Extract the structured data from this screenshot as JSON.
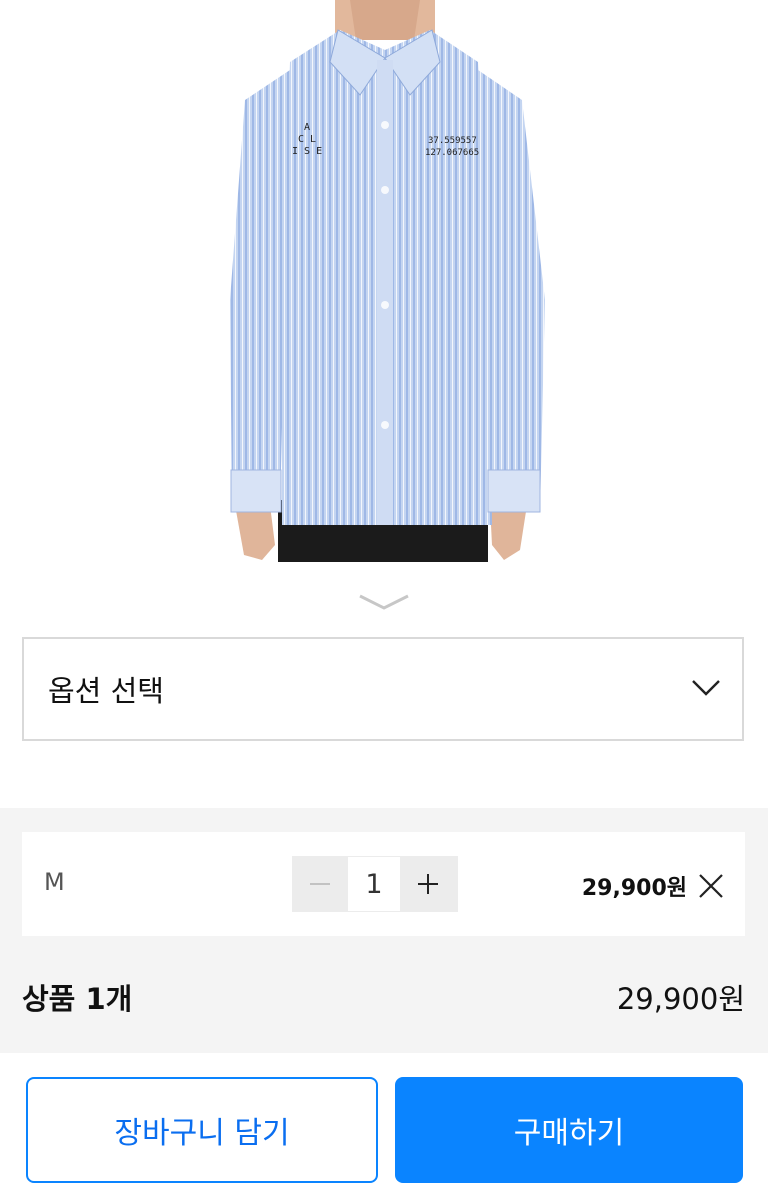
{
  "product_image": {
    "embroidery_left": [
      "A",
      "C L",
      "I S E"
    ],
    "embroidery_right": [
      "37.559557",
      "127.067665"
    ]
  },
  "option_select": {
    "placeholder": "옵션 선택"
  },
  "selected_item": {
    "option": "M",
    "quantity": "1",
    "price": "29,900원"
  },
  "total": {
    "label": "상품 1개",
    "value": "29,900원"
  },
  "actions": {
    "cart_label": "장바구니 담기",
    "buy_label": "구매하기"
  },
  "colors": {
    "accent": "#0a84ff",
    "shirt": "#b9cdee",
    "summary_bg": "#f4f4f4"
  }
}
